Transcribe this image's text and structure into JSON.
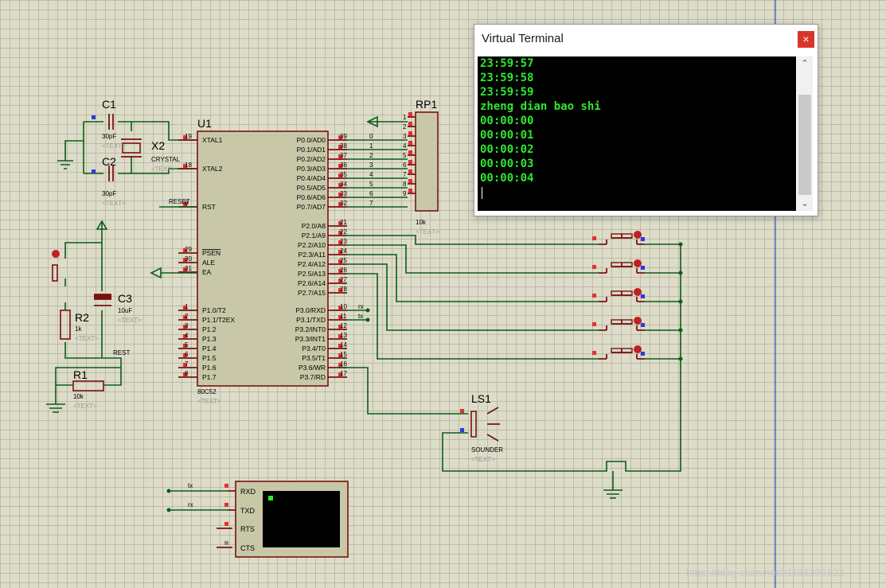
{
  "terminal": {
    "title": "Virtual Terminal",
    "close_icon": "×",
    "lines": [
      "23:59:57",
      "23:59:58",
      "23:59:59",
      "zheng dian bao shi",
      "00:00:00",
      "00:00:01",
      "00:00:02",
      "00:00:03",
      "00:00:04"
    ],
    "text_color": "#2ee82e",
    "background": "#000000"
  },
  "components": {
    "c1": {
      "ref": "C1",
      "value": "30pF",
      "text": "<TEXT>"
    },
    "c2": {
      "ref": "C2",
      "value": "30pF",
      "text": "<TEXT>"
    },
    "x2": {
      "ref": "X2",
      "value": "CRYSTAL",
      "text": "<TEXT>"
    },
    "u1": {
      "ref": "U1",
      "part": "80C52",
      "text": "<TEXT>"
    },
    "rp1": {
      "ref": "RP1",
      "value": "10k",
      "text": "<TEXT>"
    },
    "c3": {
      "ref": "C3",
      "value": "10uF",
      "text": "<TEXT>"
    },
    "r2": {
      "ref": "R2",
      "value": "1k",
      "text": "<TEXT>"
    },
    "r1": {
      "ref": "R1",
      "value": "10k",
      "text": "<TEXT>"
    },
    "ls1": {
      "ref": "LS1",
      "value": "SOUNDER",
      "text": "<TEXT>"
    }
  },
  "u1_left_pins": [
    {
      "num": "19",
      "name": "XTAL1"
    },
    {
      "num": "18",
      "name": "XTAL2"
    },
    {
      "num": "9",
      "name": "RST"
    },
    {
      "num": "29",
      "name": "PSEN"
    },
    {
      "num": "30",
      "name": "ALE"
    },
    {
      "num": "31",
      "name": "EA"
    },
    {
      "num": "1",
      "name": "P1.0/T2"
    },
    {
      "num": "2",
      "name": "P1.1/T2EX"
    },
    {
      "num": "3",
      "name": "P1.2"
    },
    {
      "num": "4",
      "name": "P1.3"
    },
    {
      "num": "5",
      "name": "P1.4"
    },
    {
      "num": "6",
      "name": "P1.5"
    },
    {
      "num": "7",
      "name": "P1.6"
    },
    {
      "num": "8",
      "name": "P1.7"
    }
  ],
  "u1_right_pins": [
    {
      "num": "39",
      "name": "P0.0/AD0",
      "net": "0"
    },
    {
      "num": "38",
      "name": "P0.1/AD1",
      "net": "1"
    },
    {
      "num": "37",
      "name": "P0.2/AD2",
      "net": "2"
    },
    {
      "num": "36",
      "name": "P0.3/AD3",
      "net": "3"
    },
    {
      "num": "35",
      "name": "P0.4/AD4",
      "net": "4"
    },
    {
      "num": "34",
      "name": "P0.5/AD5",
      "net": "5"
    },
    {
      "num": "33",
      "name": "P0.6/AD6",
      "net": "6"
    },
    {
      "num": "32",
      "name": "P0.7/AD7",
      "net": "7"
    },
    {
      "num": "21",
      "name": "P2.0/A8",
      "net": ""
    },
    {
      "num": "22",
      "name": "P2.1/A9",
      "net": ""
    },
    {
      "num": "23",
      "name": "P2.2/A10",
      "net": ""
    },
    {
      "num": "24",
      "name": "P2.3/A11",
      "net": ""
    },
    {
      "num": "25",
      "name": "P2.4/A12",
      "net": ""
    },
    {
      "num": "26",
      "name": "P2.5/A13",
      "net": ""
    },
    {
      "num": "27",
      "name": "P2.6/A14",
      "net": ""
    },
    {
      "num": "28",
      "name": "P2.7/A15",
      "net": ""
    },
    {
      "num": "10",
      "name": "P3.0/RXD",
      "net": "rx"
    },
    {
      "num": "11",
      "name": "P3.1/TXD",
      "net": "tx"
    },
    {
      "num": "12",
      "name": "P3.2/INT0",
      "net": ""
    },
    {
      "num": "13",
      "name": "P3.3/INT1",
      "net": ""
    },
    {
      "num": "14",
      "name": "P3.4/T0",
      "net": ""
    },
    {
      "num": "15",
      "name": "P3.5/T1",
      "net": ""
    },
    {
      "num": "16",
      "name": "P3.6/WR",
      "net": ""
    },
    {
      "num": "17",
      "name": "P3.7/RD",
      "net": ""
    }
  ],
  "rp1_pins": [
    "1",
    "2",
    "3",
    "4",
    "5",
    "6",
    "7",
    "8",
    "9"
  ],
  "nets": {
    "reset_left": "RESET",
    "reset_label": "REST",
    "tx": "tx",
    "rx": "rx"
  },
  "vterm_pins": [
    "RXD",
    "TXD",
    "RTS",
    "CTS"
  ],
  "watermark": "https://blog.csdn.net/x1131230123"
}
